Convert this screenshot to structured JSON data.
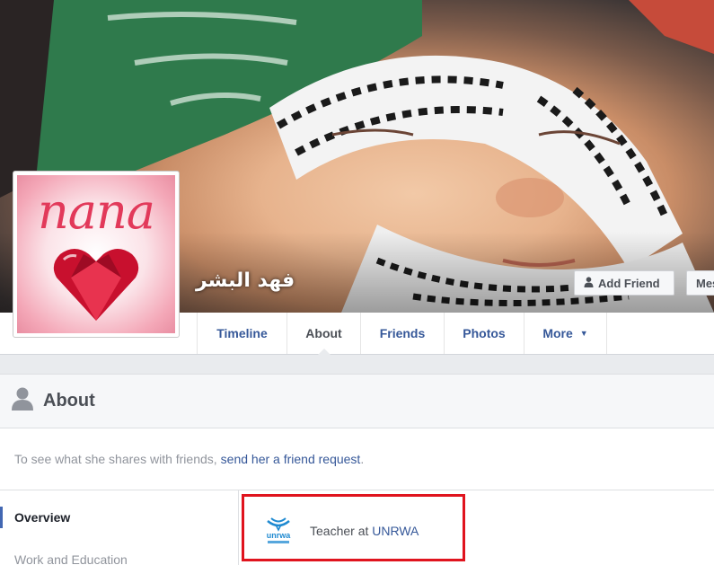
{
  "profile": {
    "name": "فهد البشر",
    "picture_caption": "nana"
  },
  "cover_actions": {
    "add_friend": "Add Friend",
    "message": "Mes"
  },
  "nav": {
    "tabs": [
      {
        "label": "Timeline"
      },
      {
        "label": "About"
      },
      {
        "label": "Friends"
      },
      {
        "label": "Photos"
      },
      {
        "label": "More"
      }
    ],
    "active": "About",
    "more_arrow": "▼"
  },
  "about": {
    "title": "About",
    "notice_text": "To see what she shares with friends,",
    "notice_link": "send her a friend request",
    "notice_end": ".",
    "sidebar": [
      {
        "label": "Overview"
      },
      {
        "label": "Work and Education"
      }
    ],
    "work": {
      "prefix": "Teacher at ",
      "employer": "UNRWA",
      "logo_text": "unrwa"
    }
  },
  "colors": {
    "link": "#365899",
    "highlight_box": "#e0141e",
    "accent": "#4267b2"
  }
}
